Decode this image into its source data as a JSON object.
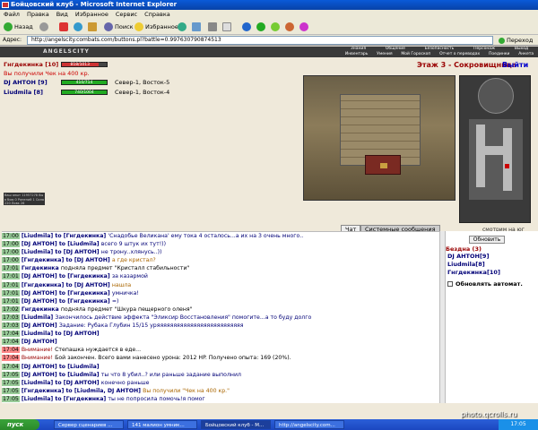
{
  "window": {
    "title": "Бойцовский клуб - Microsoft Internet Explorer"
  },
  "menu": [
    "Файл",
    "Правка",
    "Вид",
    "Избранное",
    "Сервис",
    "Справка"
  ],
  "toolbar": {
    "back": "Назад",
    "search": "Поиск",
    "favorites": "Избранное"
  },
  "address": {
    "label": "Адрес:",
    "url": "http://angelscity.combats.com/buttons.pl?battle=0.997630790874513",
    "go": "Переход"
  },
  "game": {
    "logo": "ANGELSCITY",
    "nav_row1": [
      "Знания",
      "Общение",
      "Безопасность",
      "Персонаж",
      "Выход"
    ],
    "nav_row2": [
      "Инвентарь",
      "Умения",
      "Мой Гороскоп",
      "Отчет о переводах",
      "Поединки",
      "Анкета"
    ],
    "player": {
      "name": "Гнгдекинка [10]",
      "hp": "818/1013",
      "hp_fraction": 0.81
    },
    "money": "Вы получили Чек на 400 кр.",
    "team": [
      {
        "name": "DJ АНТОН [9]",
        "bar": "410/714",
        "loc": "Север-1, Восток-5"
      },
      {
        "name": "Liudmila [8]",
        "bar": "740/1004",
        "loc": "Север-1, Восток-4"
      }
    ],
    "stage": "Этаж 3 - Сокровищница",
    "exit": "Выйти",
    "look": "смотрим на юг",
    "statbox": "Ваш опыт 11957278 Вы в бою 0 Ранений 1 Сила 220 Ловк 26"
  },
  "tabs": {
    "chat": "Чат",
    "system": "Системные сообщения"
  },
  "chat": [
    {
      "t": "17:00",
      "red": false,
      "a": "[Liudmila]",
      "b": " to [Гнгдекинка] ",
      "c": "'Снадобье Великана'      ему тока 4 осталось...а их на 3 очень много..",
      "cls": "msg"
    },
    {
      "t": "17:00",
      "red": false,
      "a": "[DJ АНТОН]",
      "b": " to [Liudmila] ",
      "c": "всего 9 штук их тут!))",
      "cls": "msg"
    },
    {
      "t": "17:00",
      "red": false,
      "a": "[Liudmila]",
      "b": " to [DJ АНТОН] ",
      "c": "не трону..хлянусь..))",
      "cls": "msg"
    },
    {
      "t": "17:00",
      "red": false,
      "a": "[Гнгдекинка]",
      "b": " to [DJ АНТОН] ",
      "c": "а где кристал?",
      "cls": "priv"
    },
    {
      "t": "17:01",
      "red": false,
      "a": "Гнгдекинка",
      "b": " ",
      "c": "подняла предмет \"Кристалл стабильности\"",
      "cls": "sp"
    },
    {
      "t": "17:01",
      "red": false,
      "a": "[DJ АНТОН]",
      "b": " to [Гнгдекинка] ",
      "c": "за казармой",
      "cls": "msg"
    },
    {
      "t": "17:01",
      "red": false,
      "a": "[Гнгдекинка]",
      "b": " to [DJ АНТОН] ",
      "c": "нашла",
      "cls": "priv"
    },
    {
      "t": "17:01",
      "red": false,
      "a": "[DJ АНТОН]",
      "b": " to [Гнгдекинка] ",
      "c": "умничка!",
      "cls": "msg"
    },
    {
      "t": "17:01",
      "red": false,
      "a": "[DJ АНТОН]",
      "b": " to [Гнгдекинка] ",
      "c": "=)",
      "cls": "msg"
    },
    {
      "t": "17:02",
      "red": false,
      "a": "Гнгдекинка",
      "b": " ",
      "c": "подняла предмет \"Шкура пещерного оленя\"",
      "cls": "sp"
    },
    {
      "t": "17:03",
      "red": false,
      "a": "[Liudmila]",
      "b": " ",
      "c": "Закончилось действие эффекта \"Эликсир Восстановления\" помогите...а то буду долго",
      "cls": "msg"
    },
    {
      "t": "17:03",
      "red": false,
      "a": "[DJ АНТОН]",
      "b": " ",
      "c": "Задание: Рубака Глубин 15/15 уряяяяяяяяяяяяяяяяяяяяяяяяяя",
      "cls": "msg"
    },
    {
      "t": "17:04",
      "red": false,
      "a": "[Liudmila]",
      "b": " to [DJ АНТОН] ",
      "c": "",
      "cls": "msg"
    },
    {
      "t": "17:04",
      "red": false,
      "a": "[DJ АНТОН]",
      "b": "",
      "c": "",
      "cls": "msg"
    },
    {
      "t": "17:04",
      "red": true,
      "a": "Внимание!",
      "b": " ",
      "c": "Степашка нуждается в еде...",
      "cls": "sp"
    },
    {
      "t": "17:04",
      "red": true,
      "a": "Внимание!",
      "b": " ",
      "c": "Бой закончен. Всего вами нанесено урона: 2012 HP. Получено опыта: 169 (20%).",
      "cls": "sp"
    },
    {
      "t": "17:04",
      "red": false,
      "a": "[DJ АНТОН]",
      "b": " to [Liudmila] ",
      "c": "",
      "cls": "msg"
    },
    {
      "t": "17:05",
      "red": false,
      "a": "[DJ АНТОН]",
      "b": " to [Liudmila] ",
      "c": "ты что 8 убил..? или раньше задание выполнил",
      "cls": "msg"
    },
    {
      "t": "17:05",
      "red": false,
      "a": "[Liudmila]",
      "b": " to [DJ АНТОН] ",
      "c": "конечно раньше",
      "cls": "msg"
    },
    {
      "t": "17:05",
      "red": false,
      "a": "[Гнгдекинка]",
      "b": " to [Liudmila, DJ АНТОН] ",
      "c": "Вы получили \"Чек на 400 кр.\"",
      "cls": "priv"
    },
    {
      "t": "17:05",
      "red": false,
      "a": "[Liudmila]",
      "b": " to [Гнгдекинка] ",
      "c": "ты не попросила помочь!я помог",
      "cls": "msg"
    },
    {
      "t": "17:05",
      "red": false,
      "a": "[Гнгдекинка]",
      "b": "",
      "c": "",
      "cls": "priv"
    }
  ],
  "side": {
    "refresh": "Обновить",
    "battle": "Бездна (3)",
    "members": [
      "DJ АНТОН[9]",
      "Liudmila[8]",
      "Гнгдекинка[10]"
    ],
    "auto": "Обновлять автомат."
  },
  "taskbar": {
    "start": "пуск",
    "tasks": [
      "Сервер сценариев ...",
      "141 малион умник...",
      "Бойцовский клуб - М...",
      "http://angelscity.com..."
    ],
    "clock": "17:05"
  },
  "watermark": "photo.qcrolls.ru"
}
